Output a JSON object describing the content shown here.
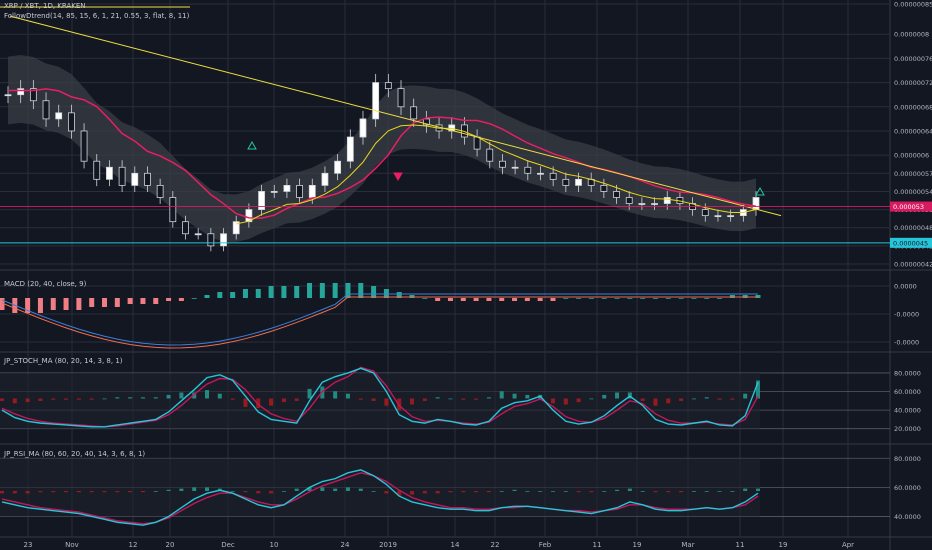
{
  "legend": {
    "symbol": "XRP / XBT, 1D, KRAKEN",
    "indicator_main": "FollowDtrend(14, 85, 15, 6, 1, 21, 0.55, 3, flat, 8, 11)",
    "macd": "MACD (20, 40, close, 9)",
    "stoch": "JP_STOCH_MA (80, 20, 14, 3, 8, 1)",
    "rsi": "JP_RSI_MA (80, 60, 20, 40, 14, 3, 6, 8, 1)"
  },
  "price_badges": {
    "current": "0.000053",
    "support": "0.0000045"
  },
  "colors": {
    "background": "#131722",
    "grid": "#2a2e39",
    "ema_red": "#e91e63",
    "cloud_yellow": "#e8d61c",
    "trendline": "#f0e040",
    "cyan": "#26c6da",
    "macd_bear": "#ef7f85",
    "macd_bull": "#26a69a",
    "stoch_signal": "#c2185b",
    "price_line": "#d81b60"
  },
  "chart_data": [
    {
      "type": "candlestick",
      "pane": "price",
      "title": "XRP / XBT, 1D, KRAKEN",
      "y_ticks": [
        "0.00000085",
        "0.0000008",
        "0.00000076",
        "0.00000072",
        "0.00000068",
        "0.00000064",
        "0.0000006",
        "0.00000057",
        "0.00000054",
        "0.00000051",
        "0.00000048",
        "0.00000045",
        "0.00000042"
      ],
      "x_ticks": [
        "23",
        "Nov",
        "12",
        "20",
        "Dec",
        "10",
        "24",
        "2019",
        "14",
        "22",
        "Feb",
        "11",
        "19",
        "Mar",
        "11",
        "19",
        "Apr"
      ],
      "ylim": [
        4.2e-07,
        8.5e-07
      ],
      "close_series": [
        7e-07,
        7.1e-07,
        6.9e-07,
        6.6e-07,
        6.7e-07,
        6.4e-07,
        5.9e-07,
        5.6e-07,
        5.8e-07,
        5.5e-07,
        5.7e-07,
        5.5e-07,
        5.3e-07,
        4.9e-07,
        4.7e-07,
        4.7e-07,
        4.5e-07,
        4.7e-07,
        4.9e-07,
        5.1e-07,
        5.4e-07,
        5.4e-07,
        5.5e-07,
        5.3e-07,
        5.5e-07,
        5.7e-07,
        5.9e-07,
        6.3e-07,
        6.6e-07,
        7.2e-07,
        7.1e-07,
        6.8e-07,
        6.6e-07,
        6.5e-07,
        6.4e-07,
        6.5e-07,
        6.3e-07,
        6.1e-07,
        5.9e-07,
        5.8e-07,
        5.8e-07,
        5.7e-07,
        5.7e-07,
        5.6e-07,
        5.5e-07,
        5.6e-07,
        5.5e-07,
        5.4e-07,
        5.3e-07,
        5.2e-07,
        5.2e-07,
        5.2e-07,
        5.3e-07,
        5.2e-07,
        5.1e-07,
        5e-07,
        5e-07,
        5e-07,
        5.1e-07,
        5.3e-07
      ],
      "trendline": {
        "start": 8.3e-07,
        "end": 5e-07
      },
      "support_line": 4.55e-07,
      "current_price": 5.15e-07
    },
    {
      "type": "histogram",
      "pane": "macd",
      "title": "MACD (20, 40, close, 9)",
      "y_ticks": [
        "0.0000",
        "-0.0000",
        "-0.0000"
      ],
      "hist": [
        -4,
        -5,
        -5,
        -5,
        -4,
        -4,
        -4,
        -3,
        -3,
        -3,
        -2,
        -2,
        -2,
        -1,
        -1,
        0,
        1,
        2,
        2,
        3,
        3,
        4,
        4,
        4,
        5,
        5,
        5,
        5,
        5,
        4,
        3,
        2,
        1,
        0,
        -1,
        -1,
        -1,
        -1,
        -1,
        -1,
        -1,
        -1,
        -1,
        -1,
        0,
        0,
        0,
        0,
        0,
        0,
        0,
        0,
        0,
        0,
        0,
        0,
        0,
        1,
        1,
        1
      ]
    },
    {
      "type": "line",
      "pane": "stoch",
      "title": "JP_STOCH_MA (80, 20, 14, 3, 8, 1)",
      "y_ticks": [
        "80.0000",
        "60.0000",
        "40.0000",
        "20.0000"
      ],
      "ylim": [
        10,
        95
      ],
      "series": [
        {
          "values": [
            40,
            32,
            28,
            26,
            25,
            24,
            23,
            22,
            22,
            24,
            26,
            28,
            30,
            38,
            50,
            62,
            75,
            78,
            72,
            55,
            38,
            30,
            28,
            26,
            50,
            70,
            76,
            80,
            85,
            80,
            60,
            35,
            28,
            26,
            30,
            28,
            25,
            24,
            28,
            42,
            48,
            50,
            55,
            40,
            28,
            25,
            27,
            34,
            45,
            55,
            45,
            30,
            25,
            24,
            26,
            28,
            24,
            23,
            34,
            70
          ]
        },
        {
          "values": [
            42,
            36,
            31,
            28,
            26,
            25,
            24,
            23,
            22,
            23,
            25,
            27,
            29,
            35,
            45,
            57,
            68,
            74,
            73,
            62,
            46,
            36,
            31,
            28,
            42,
            60,
            70,
            76,
            86,
            82,
            66,
            45,
            33,
            28,
            29,
            28,
            26,
            25,
            27,
            36,
            44,
            47,
            52,
            44,
            33,
            28,
            27,
            31,
            40,
            50,
            47,
            36,
            29,
            26,
            26,
            27,
            25,
            24,
            30,
            55
          ]
        }
      ]
    },
    {
      "type": "line",
      "pane": "rsi",
      "title": "JP_RSI_MA (80, 60, 20, 40, 14, 3, 6, 8, 1)",
      "y_ticks": [
        "80.0000",
        "60.0000",
        "40.0000"
      ],
      "ylim": [
        30,
        85
      ],
      "series": [
        {
          "values": [
            50,
            48,
            46,
            45,
            44,
            43,
            42,
            40,
            38,
            36,
            35,
            34,
            36,
            40,
            46,
            52,
            56,
            58,
            56,
            52,
            48,
            46,
            48,
            54,
            60,
            64,
            66,
            70,
            72,
            68,
            62,
            54,
            50,
            48,
            46,
            45,
            45,
            44,
            44,
            46,
            47,
            47,
            46,
            45,
            44,
            43,
            42,
            44,
            46,
            50,
            48,
            45,
            44,
            44,
            45,
            46,
            45,
            46,
            50,
            56
          ]
        },
        {
          "values": [
            52,
            50,
            48,
            46,
            45,
            44,
            43,
            41,
            39,
            37,
            36,
            35,
            36,
            39,
            44,
            49,
            53,
            56,
            56,
            53,
            50,
            48,
            48,
            52,
            57,
            61,
            64,
            67,
            70,
            68,
            64,
            58,
            53,
            50,
            48,
            46,
            46,
            45,
            45,
            46,
            46,
            47,
            46,
            45,
            44,
            44,
            43,
            44,
            45,
            48,
            48,
            46,
            45,
            45,
            45,
            46,
            45,
            46,
            48,
            54
          ]
        }
      ]
    }
  ]
}
